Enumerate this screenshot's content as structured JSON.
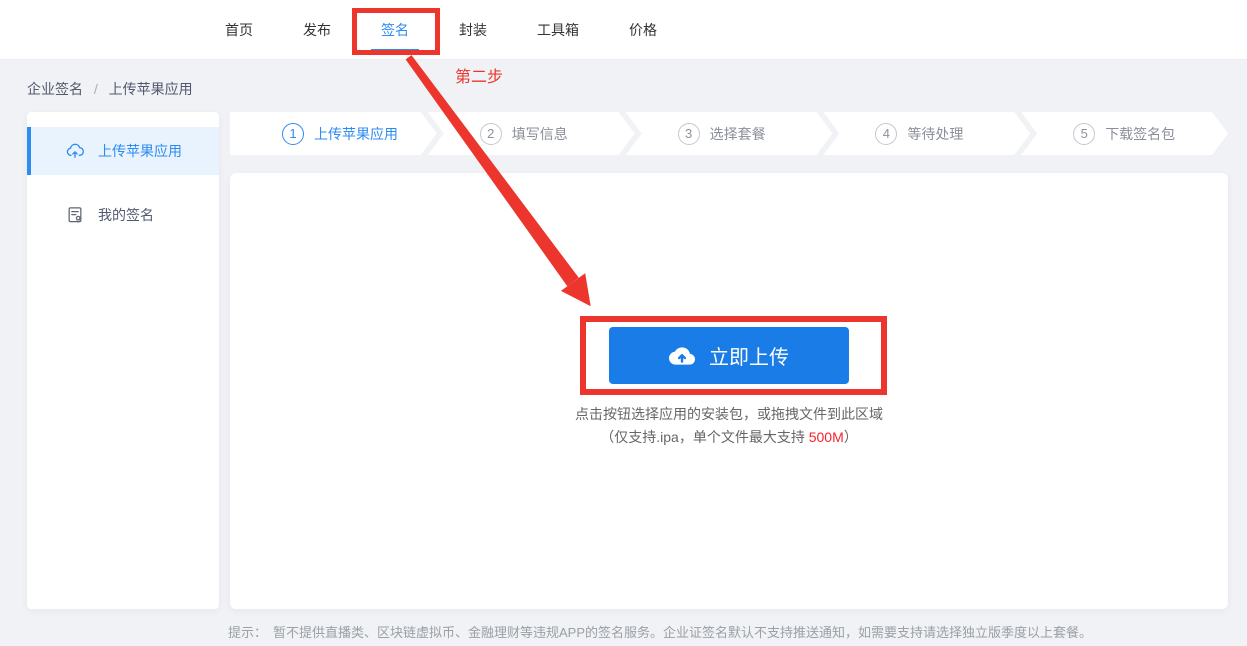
{
  "nav": {
    "items": [
      {
        "label": "首页"
      },
      {
        "label": "发布"
      },
      {
        "label": "签名",
        "active": true
      },
      {
        "label": "封装"
      },
      {
        "label": "工具箱"
      },
      {
        "label": "价格"
      }
    ]
  },
  "breadcrumb": {
    "parent": "企业签名",
    "separator": "/",
    "current": "上传苹果应用"
  },
  "sidebar": {
    "items": [
      {
        "icon": "cloud-upload-icon",
        "label": "上传苹果应用",
        "active": true
      },
      {
        "icon": "signature-doc-icon",
        "label": "我的签名",
        "active": false
      }
    ]
  },
  "steps": [
    {
      "num": "1",
      "label": "上传苹果应用",
      "active": true
    },
    {
      "num": "2",
      "label": "填写信息",
      "active": false
    },
    {
      "num": "3",
      "label": "选择套餐",
      "active": false
    },
    {
      "num": "4",
      "label": "等待处理",
      "active": false
    },
    {
      "num": "5",
      "label": "下载签名包",
      "active": false
    }
  ],
  "upload": {
    "button_label": "立即上传",
    "hint_line1": "点击按钮选择应用的安装包，或拖拽文件到此区域",
    "hint_line2_prefix": "（仅支持.ipa，单个文件最大支持 ",
    "hint_size": "500M",
    "hint_line2_suffix": "）"
  },
  "footer": {
    "tip_label": "提示：",
    "tip_text": "暂不提供直播类、区块链虚拟币、金融理财等违规APP的签名服务。企业证签名默认不支持推送通知，如需要支持请选择独立版季度以上套餐。"
  },
  "annotations": {
    "step_label": "第二步"
  },
  "colors": {
    "accent_blue": "#2d8cf0",
    "button_blue": "#1a7ce6",
    "annotation_red": "#ec352c",
    "size_red": "#f5222d",
    "page_bg": "#f0f2f5",
    "active_item_bg": "#e8f3fe"
  }
}
